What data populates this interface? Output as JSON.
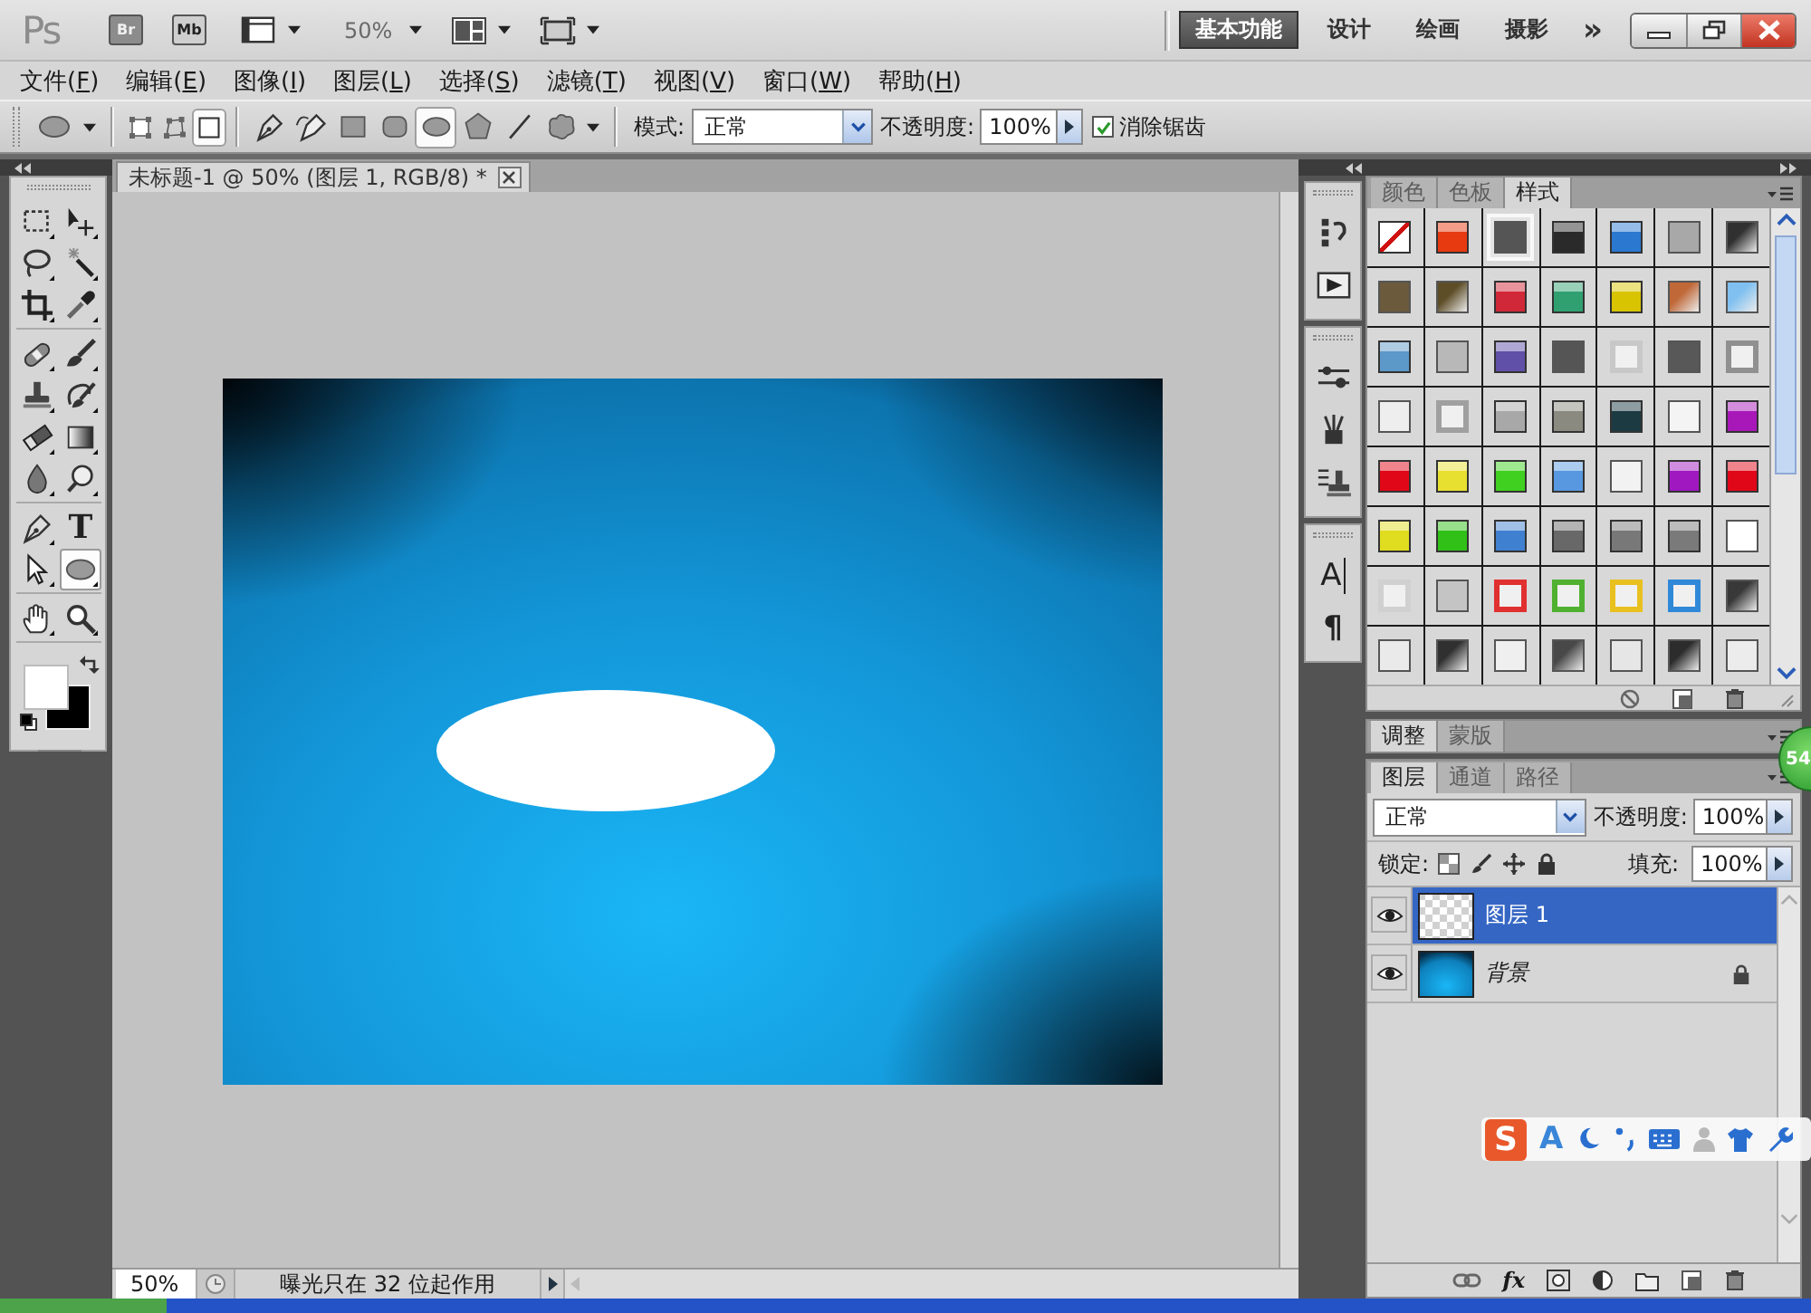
{
  "title_bar": {
    "logo": "Ps",
    "apps": [
      "Br",
      "Mb"
    ],
    "zoom": "50%",
    "workspaces": [
      {
        "label": "基本功能",
        "selected": true
      },
      {
        "label": "设计",
        "selected": false
      },
      {
        "label": "绘画",
        "selected": false
      },
      {
        "label": "摄影",
        "selected": false
      }
    ],
    "more": "»"
  },
  "menu": [
    {
      "label": "文件(",
      "key": "F",
      "end": ")"
    },
    {
      "label": "编辑(",
      "key": "E",
      "end": ")"
    },
    {
      "label": "图像(",
      "key": "I",
      "end": ")"
    },
    {
      "label": "图层(",
      "key": "L",
      "end": ")"
    },
    {
      "label": "选择(",
      "key": "S",
      "end": ")"
    },
    {
      "label": "滤镜(",
      "key": "T",
      "end": ")"
    },
    {
      "label": "视图(",
      "key": "V",
      "end": ")"
    },
    {
      "label": "窗口(",
      "key": "W",
      "end": ")"
    },
    {
      "label": "帮助(",
      "key": "H",
      "end": ")"
    }
  ],
  "options_bar": {
    "path_modes": [
      {
        "kind": "layers",
        "selected": false
      },
      {
        "kind": "paths",
        "selected": false
      },
      {
        "kind": "pixels",
        "selected": true
      }
    ],
    "shapes": [
      {
        "kind": "pen",
        "selected": false
      },
      {
        "kind": "freepen",
        "selected": false
      },
      {
        "kind": "rect",
        "selected": false
      },
      {
        "kind": "rounded",
        "selected": false
      },
      {
        "kind": "ellipse",
        "selected": true
      },
      {
        "kind": "polygon",
        "selected": false
      },
      {
        "kind": "line",
        "selected": false
      },
      {
        "kind": "custom",
        "selected": false
      }
    ],
    "mode_label": "模式:",
    "mode_value": "正常",
    "opacity_label": "不透明度:",
    "opacity_value": "100%",
    "antialias": {
      "label": "消除锯齿",
      "checked": true
    }
  },
  "toolbox": {
    "groups": [
      [
        {
          "kind": "marquee",
          "selected": false
        },
        {
          "kind": "move",
          "selected": false
        },
        {
          "kind": "lasso",
          "selected": false
        },
        {
          "kind": "wand",
          "selected": false
        },
        {
          "kind": "crop",
          "selected": false
        },
        {
          "kind": "eyedropper",
          "selected": false
        }
      ],
      [
        {
          "kind": "heal",
          "selected": false
        },
        {
          "kind": "brush",
          "selected": false
        },
        {
          "kind": "stamp",
          "selected": false
        },
        {
          "kind": "histbrush",
          "selected": false
        },
        {
          "kind": "eraser",
          "selected": false
        },
        {
          "kind": "gradient",
          "selected": false
        },
        {
          "kind": "smudge",
          "selected": false
        },
        {
          "kind": "dodge",
          "selected": false
        }
      ],
      [
        {
          "kind": "pen",
          "selected": false
        },
        {
          "kind": "type",
          "glyph": "T",
          "selected": false
        },
        {
          "kind": "pathsel",
          "selected": false
        },
        {
          "kind": "ellipse",
          "selected": true
        }
      ],
      [
        {
          "kind": "hand",
          "selected": false
        },
        {
          "kind": "zoom",
          "selected": false
        }
      ]
    ],
    "color_swatches": [
      {
        "kind": "foreground",
        "color": "#ffffff"
      },
      {
        "kind": "background",
        "color": "#000000"
      }
    ]
  },
  "document": {
    "tab_title": "未标题-1 @ 50% (图层 1, RGB/8) *",
    "zoom": "50%",
    "status": "曝光只在 32 位起作用"
  },
  "dock": {
    "groups": [
      [
        {
          "kind": "history"
        },
        {
          "kind": "actions"
        }
      ],
      [
        {
          "kind": "adjust"
        },
        {
          "kind": "brushes"
        },
        {
          "kind": "clone"
        }
      ],
      [
        {
          "kind": "character",
          "glyph": "A"
        },
        {
          "kind": "paragraph",
          "glyph": "¶"
        }
      ]
    ]
  },
  "styles_panel": {
    "tabs": [
      {
        "label": "颜色",
        "selected": false
      },
      {
        "label": "色板",
        "selected": false
      },
      {
        "label": "样式",
        "selected": true
      }
    ],
    "swatches": [
      {
        "kind": "none",
        "color": "#ffffff",
        "selected": false
      },
      {
        "kind": "gloss",
        "color": "#e83a10",
        "selected": false
      },
      {
        "kind": "flat",
        "color": "#555555",
        "selected": true
      },
      {
        "kind": "gloss",
        "color": "#2a2a2a",
        "selected": false
      },
      {
        "kind": "gloss",
        "color": "#2a78d0",
        "selected": false
      },
      {
        "kind": "flat",
        "color": "#a8a8a8",
        "selected": false
      },
      {
        "kind": "gradient",
        "color": "#303030",
        "selected": false
      },
      {
        "kind": "flat",
        "color": "#6b5a3c",
        "selected": false
      },
      {
        "kind": "gradient",
        "color": "#5e4e28",
        "selected": false
      },
      {
        "kind": "gloss",
        "color": "#d02838",
        "selected": false
      },
      {
        "kind": "gloss",
        "color": "#30a070",
        "selected": false
      },
      {
        "kind": "gloss",
        "color": "#d8c400",
        "selected": false
      },
      {
        "kind": "gradient",
        "color": "#c06838",
        "selected": false
      },
      {
        "kind": "gradient",
        "color": "#80c0f0",
        "selected": false
      },
      {
        "kind": "gloss",
        "color": "#5c98c8",
        "selected": false
      },
      {
        "kind": "flat",
        "color": "#b8b8b8",
        "selected": false
      },
      {
        "kind": "gloss",
        "color": "#6050a8",
        "selected": false
      },
      {
        "kind": "flat",
        "color": "#555555",
        "selected": false
      },
      {
        "kind": "frame",
        "color": "#c8c8c8",
        "selected": false
      },
      {
        "kind": "flat",
        "color": "#585858",
        "selected": false
      },
      {
        "kind": "frame",
        "color": "#909090",
        "selected": false
      },
      {
        "kind": "flat",
        "color": "#eeeeee",
        "selected": false
      },
      {
        "kind": "frame",
        "color": "#a0a0a0",
        "selected": false
      },
      {
        "kind": "gloss",
        "color": "#a8a8a8",
        "selected": false
      },
      {
        "kind": "gloss",
        "color": "#8a8a80",
        "selected": false
      },
      {
        "kind": "gloss",
        "color": "#1c3a42",
        "selected": false
      },
      {
        "kind": "flat",
        "color": "#f4f4f4",
        "selected": false
      },
      {
        "kind": "gloss",
        "color": "#a818b8",
        "selected": false
      },
      {
        "kind": "gloss",
        "color": "#e00818",
        "selected": false
      },
      {
        "kind": "gloss",
        "color": "#e8e030",
        "selected": false
      },
      {
        "kind": "gloss",
        "color": "#40d020",
        "selected": false
      },
      {
        "kind": "gloss",
        "color": "#5898e0",
        "selected": false
      },
      {
        "kind": "flat",
        "color": "#f2f2f2",
        "selected": false
      },
      {
        "kind": "gloss",
        "color": "#a018c0",
        "selected": false
      },
      {
        "kind": "gloss",
        "color": "#e00818",
        "selected": false
      },
      {
        "kind": "gloss",
        "color": "#e0dc20",
        "selected": false
      },
      {
        "kind": "gloss",
        "color": "#30c018",
        "selected": false
      },
      {
        "kind": "gloss",
        "color": "#4080d0",
        "selected": false
      },
      {
        "kind": "gloss",
        "color": "#686868",
        "selected": false
      },
      {
        "kind": "gloss",
        "color": "#787878",
        "selected": false
      },
      {
        "kind": "gloss",
        "color": "#7a7a7a",
        "selected": false
      },
      {
        "kind": "flat",
        "color": "#ffffff",
        "selected": false
      },
      {
        "kind": "frame",
        "color": "#d0d0d0",
        "selected": false
      },
      {
        "kind": "flat",
        "color": "#c4c4c4",
        "selected": false
      },
      {
        "kind": "frame",
        "color": "#e03030",
        "selected": false
      },
      {
        "kind": "frame",
        "color": "#50b030",
        "selected": false
      },
      {
        "kind": "frame",
        "color": "#e8c020",
        "selected": false
      },
      {
        "kind": "frame",
        "color": "#3088d8",
        "selected": false
      },
      {
        "kind": "gradient",
        "color": "#383838",
        "selected": false
      },
      {
        "kind": "flat",
        "color": "#eaeaea",
        "selected": false
      },
      {
        "kind": "gradient",
        "color": "#303030",
        "selected": false
      },
      {
        "kind": "flat",
        "color": "#efefef",
        "selected": false
      },
      {
        "kind": "gradient",
        "color": "#484848",
        "selected": false
      },
      {
        "kind": "flat",
        "color": "#e6e6e6",
        "selected": false
      },
      {
        "kind": "gradient",
        "color": "#2c2c2c",
        "selected": false
      },
      {
        "kind": "flat",
        "color": "#ececec",
        "selected": false
      }
    ]
  },
  "adjust_panel": {
    "tabs": [
      {
        "label": "调整",
        "selected": true
      },
      {
        "label": "蒙版",
        "selected": false
      }
    ]
  },
  "layers_panel": {
    "tabs": [
      {
        "label": "图层",
        "selected": true
      },
      {
        "label": "通道",
        "selected": false
      },
      {
        "label": "路径",
        "selected": false
      }
    ],
    "blend_mode": "正常",
    "opacity_label": "不透明度:",
    "opacity": "100%",
    "lock_label": "锁定:",
    "fill_label": "填充:",
    "fill": "100%",
    "layers": [
      {
        "name": "图层 1",
        "kind": "layer",
        "visible": true,
        "selected": true
      },
      {
        "name": "背景",
        "kind": "background",
        "visible": true,
        "selected": false
      }
    ],
    "fx_label": "fx"
  },
  "ime_toolbar": {
    "logo": "S",
    "mode": "A"
  },
  "badge": "54"
}
